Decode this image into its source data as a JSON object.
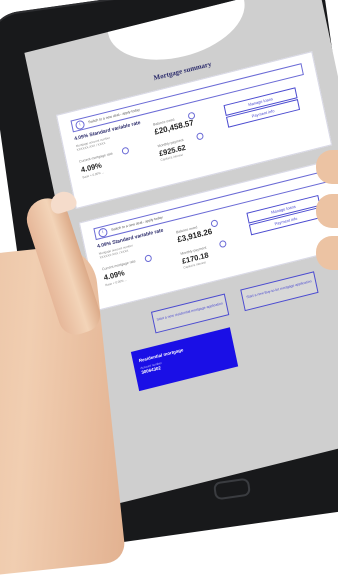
{
  "page": {
    "title": "Mortgage summary"
  },
  "mortgage_1": {
    "notice": "Switch to a new deal - apply today",
    "rate_title": "4.09% Standard variable rate",
    "account_label": "Mortgage account number",
    "account_number": "XXXXXX-XXX / XXXX",
    "balance_label": "Balance owed",
    "balance_value": "£20,458.57",
    "rate_label": "Current mortgage rate",
    "rate_value": "4.09%",
    "rate_sub": "Base + 0.00% ...",
    "monthly_label": "Monthly payment",
    "monthly_value": "£925.62",
    "monthly_sub": "Capital & interest",
    "btn_primary": "Manage loans",
    "btn_secondary": "Payment info"
  },
  "mortgage_2": {
    "notice": "Switch to a new deal - apply today",
    "rate_title": "4.09% Standard variable rate",
    "account_label": "Mortgage account number",
    "account_number": "XXXXXX-XXX / XXXX",
    "balance_label": "Balance owed",
    "balance_value": "£3,918.26",
    "rate_label": "Current mortgage rate",
    "rate_value": "4.09%",
    "rate_sub": "Base + 0.00% ...",
    "monthly_label": "Monthly payment",
    "monthly_value": "£170.18",
    "monthly_sub": "Capital & interest",
    "btn_primary": "Manage loans",
    "btn_secondary": "Payment info"
  },
  "actions": {
    "apply_residential": "Start a new residential mortgage application",
    "apply_btl": "Start a new Buy-to-let mortgage application"
  },
  "residential_tile": {
    "title": "Residential mortgage",
    "label": "Account number",
    "number": "30064302"
  }
}
